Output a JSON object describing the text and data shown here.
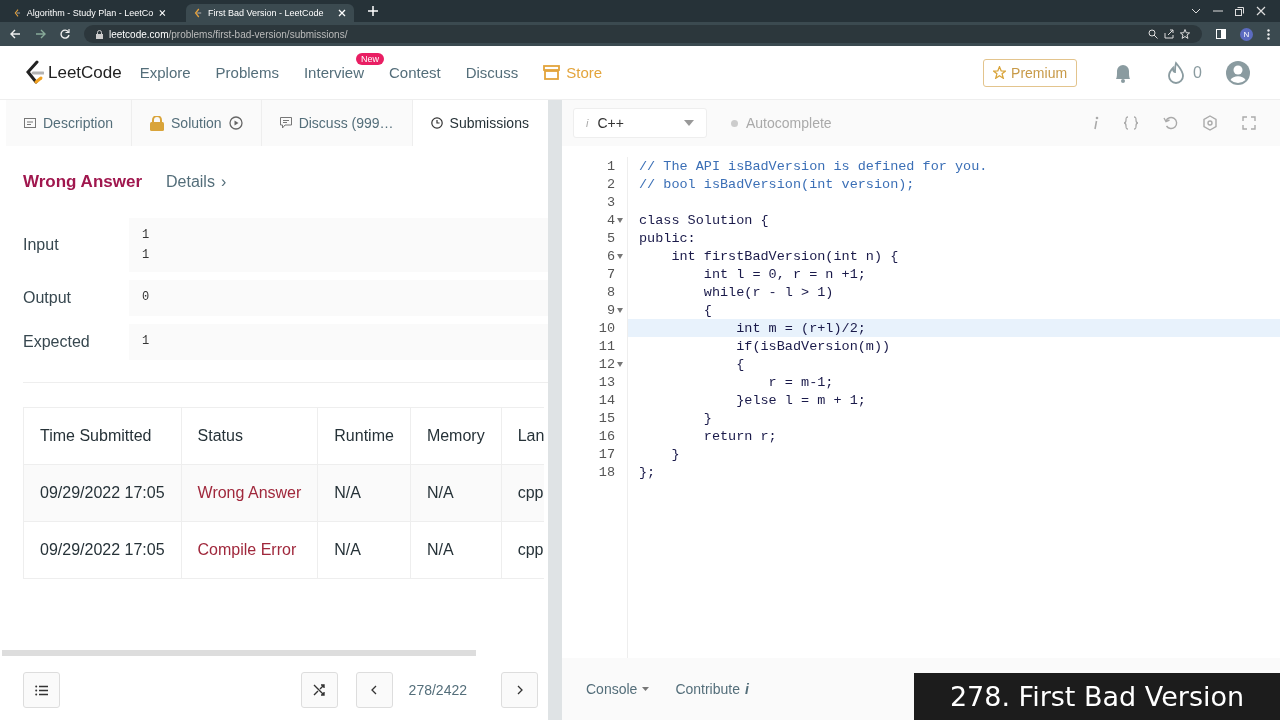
{
  "browser": {
    "tabs": [
      {
        "title": "Algorithm - Study Plan - LeetCo",
        "selected": false
      },
      {
        "title": "First Bad Version - LeetCode",
        "selected": true
      }
    ],
    "url_host": "leetcode.com",
    "url_path": "/problems/first-bad-version/submissions/",
    "profile": "N"
  },
  "nav": {
    "logo": "LeetCode",
    "links": [
      {
        "label": "Explore",
        "kind": "plain"
      },
      {
        "label": "Problems",
        "kind": "plain"
      },
      {
        "label": "Interview",
        "kind": "badge",
        "badge": "New"
      },
      {
        "label": "Contest",
        "kind": "plain"
      },
      {
        "label": "Discuss",
        "kind": "plain"
      },
      {
        "label": "Store",
        "kind": "store"
      }
    ],
    "premium": "Premium",
    "streak": "0"
  },
  "tabs": [
    {
      "label": "Description",
      "selected": false
    },
    {
      "label": "Solution",
      "selected": false
    },
    {
      "label": "Discuss (999…",
      "selected": false
    },
    {
      "label": "Submissions",
      "selected": true
    }
  ],
  "result": {
    "status": "Wrong Answer",
    "details": "Details",
    "details_arrow": "›",
    "fields": [
      {
        "label": "Input",
        "lines": [
          "1",
          "1"
        ]
      },
      {
        "label": "Output",
        "lines": [
          "0"
        ]
      },
      {
        "label": "Expected",
        "lines": [
          "1"
        ]
      }
    ]
  },
  "table": {
    "columns": [
      "Time Submitted",
      "Status",
      "Runtime",
      "Memory",
      "Lan"
    ],
    "rows": [
      {
        "time": "09/29/2022 17:05",
        "status": "Wrong Answer",
        "runtime": "N/A",
        "memory": "N/A",
        "lang": "cpp"
      },
      {
        "time": "09/29/2022 17:05",
        "status": "Compile Error",
        "runtime": "N/A",
        "memory": "N/A",
        "lang": "cpp"
      }
    ]
  },
  "pager": "278/2422",
  "editor": {
    "language_info": "i",
    "language": "C++",
    "autocomplete": "Autocomplete",
    "lines": [
      {
        "number": "1",
        "text": "// The API isBadVersion is defined for you.",
        "kind": "comment",
        "foldable": false,
        "selected": false
      },
      {
        "number": "2",
        "text": "// bool isBadVersion(int version);",
        "kind": "comment",
        "foldable": false,
        "selected": false
      },
      {
        "number": "3",
        "kind": "code",
        "foldable": false,
        "selected": false
      },
      {
        "number": "4",
        "text": "class Solution {",
        "kind": "code",
        "foldable": true,
        "selected": false
      },
      {
        "number": "5",
        "text": "public:",
        "kind": "code",
        "foldable": false,
        "selected": false
      },
      {
        "number": "6",
        "text": "    int firstBadVersion(int n) {",
        "kind": "code",
        "foldable": true,
        "selected": false
      },
      {
        "number": "7",
        "text": "        int l = 0, r = n +1;",
        "kind": "code",
        "foldable": false,
        "selected": false
      },
      {
        "number": "8",
        "text": "        while(r - l > 1)",
        "kind": "code",
        "foldable": false,
        "selected": false
      },
      {
        "number": "9",
        "text": "        {",
        "kind": "code",
        "foldable": true,
        "selected": false
      },
      {
        "number": "10",
        "text": "            int m = (r+l)/2;",
        "kind": "code",
        "foldable": false,
        "selected": true
      },
      {
        "number": "11",
        "text": "            if(isBadVersion(m))",
        "kind": "code",
        "foldable": false,
        "selected": false
      },
      {
        "number": "12",
        "text": "            {",
        "kind": "code",
        "foldable": true,
        "selected": false
      },
      {
        "number": "13",
        "text": "                r = m-1;",
        "kind": "code",
        "foldable": false,
        "selected": false
      },
      {
        "number": "14",
        "text": "            }else l = m + 1;",
        "kind": "code",
        "foldable": false,
        "selected": false
      },
      {
        "number": "15",
        "text": "        }",
        "kind": "code",
        "foldable": false,
        "selected": false
      },
      {
        "number": "16",
        "text": "        return r;",
        "kind": "code",
        "foldable": false,
        "selected": false
      },
      {
        "number": "17",
        "text": "    }",
        "kind": "code",
        "foldable": false,
        "selected": false
      },
      {
        "number": "18",
        "text": "};",
        "kind": "code",
        "foldable": false,
        "selected": false
      }
    ],
    "console": "Console",
    "contribute": "Contribute",
    "contribute_info": "i"
  },
  "caption": "278. First Bad Version"
}
